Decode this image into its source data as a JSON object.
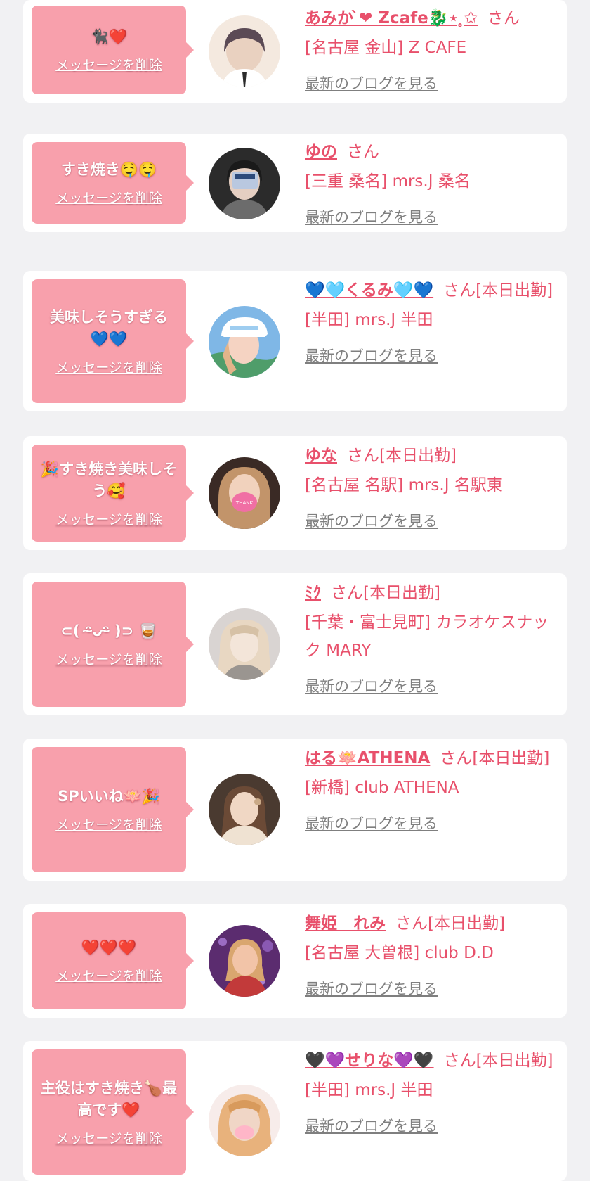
{
  "messages": [
    {
      "text": "🐈‍⬛❤️",
      "delete_label": "メッセージを削除",
      "name": "あみか ̀❤︎ Zcafe🐉⋆ ̥✩",
      "honorific": "さん",
      "shop": "[名古屋 金山] Z CAFE",
      "blog_link": "最新のブログを見る",
      "avatar_colors": [
        "#f4e9df",
        "#d8c6b4",
        "#5b4a55"
      ]
    },
    {
      "text": "すき焼き🤤🤤",
      "delete_label": "メッセージを削除",
      "name": "ゆの",
      "honorific": "さん",
      "shop": "[三重 桑名] mrs.J 桑名",
      "blog_link": "最新のブログを見る",
      "avatar_colors": [
        "#6c6c6c",
        "#2b2b2b",
        "#b9c8e0"
      ]
    },
    {
      "text": "美味しそうすぎる💙💙",
      "delete_label": "メッセージを削除",
      "name": "💙🩵くるみ🩵💙",
      "honorific": "さん[本日出勤]",
      "shop": "[半田] mrs.J 半田",
      "blog_link": "最新のブログを見る",
      "avatar_colors": [
        "#9ecdf0",
        "#f5d3c2",
        "#ffffff"
      ]
    },
    {
      "text": "🎉すき焼き美味しそう🥰",
      "delete_label": "メッセージを削除",
      "name": "ゆな",
      "honorific": "さん[本日出勤]",
      "shop": "[名古屋 名駅] mrs.J 名駅東",
      "blog_link": "最新のブログを見る",
      "avatar_colors": [
        "#3a2a25",
        "#c2946a",
        "#f06fa4"
      ]
    },
    {
      "text": "⊂( ᵔ̴ᴗᵔ̴ )⊃ 🥃",
      "delete_label": "メッセージを削除",
      "name": "ﾐｸ",
      "honorific": "さん[本日出勤]",
      "shop": "[千葉・富士見町] カラオケスナック MARY",
      "blog_link": "最新のブログを見る",
      "avatar_colors": [
        "#d9d4d2",
        "#f3e5d9",
        "#9a9590"
      ]
    },
    {
      "text": "SPいいね🪷🎉",
      "delete_label": "メッセージを削除",
      "name": "はる🪷ATHENA",
      "honorific": "さん[本日出勤]",
      "shop": "[新橋] club ATHENA",
      "blog_link": "最新のブログを見る",
      "avatar_colors": [
        "#4a3a30",
        "#c9a987",
        "#efe2d2"
      ]
    },
    {
      "text": "❤️❤️❤️",
      "delete_label": "メッセージを削除",
      "name": "舞姫　れみ",
      "honorific": "さん[本日出勤]",
      "shop": "[名古屋 大曽根] club D.D",
      "blog_link": "最新のブログを見る",
      "avatar_colors": [
        "#5b2c6f",
        "#c23a3a",
        "#f2c4a8"
      ]
    },
    {
      "text": "主役はすき焼き🍗最高です❤️",
      "delete_label": "メッセージを削除",
      "name": "🖤💜せりな💜🖤",
      "honorific": "さん[本日出勤]",
      "shop": "[半田] mrs.J 半田",
      "blog_link": "最新のブログを見る",
      "avatar_colors": [
        "#f0d6c6",
        "#e8b27c",
        "#ffb6c8"
      ]
    }
  ],
  "theme": {
    "accent": "#e8506b",
    "bubble": "#f8a0ac",
    "background": "#f1f1f3",
    "link_gray": "#7f7f7f"
  }
}
